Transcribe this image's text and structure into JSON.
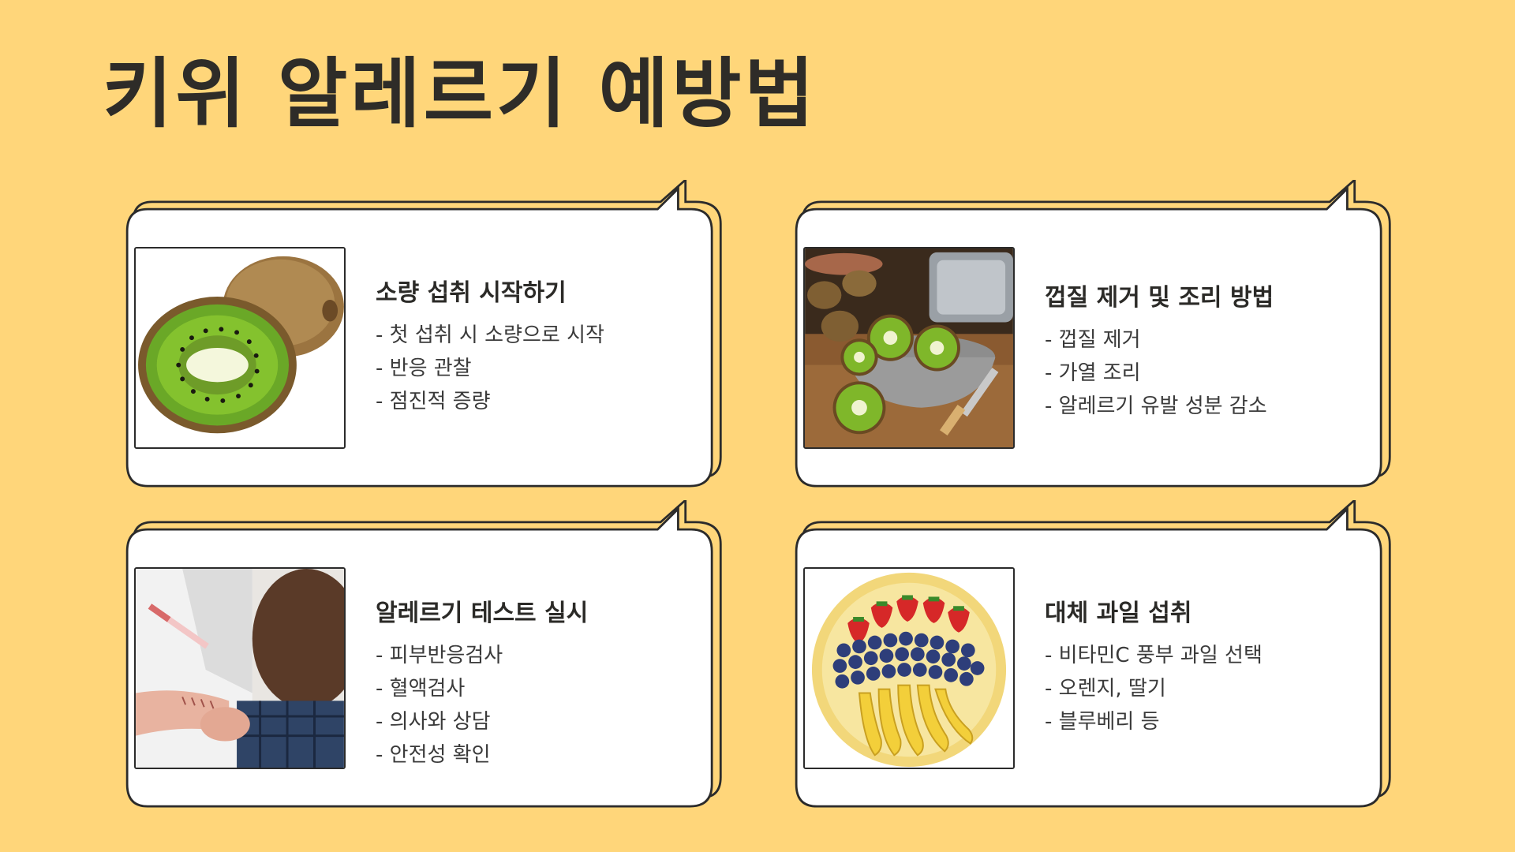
{
  "title": "키위 알레르기 예방법",
  "colors": {
    "background": "#FFD67A",
    "card_fill": "#FFFFFF",
    "card_outline": "#2B2B2B",
    "card_shadow": "#FFD67A"
  },
  "cards": [
    {
      "heading": "소량 섭취 시작하기",
      "icon": "kiwi-halves-image",
      "items": [
        "- 첫 섭취 시 소량으로 시작",
        "- 반응 관찰",
        "- 점진적 증량"
      ]
    },
    {
      "heading": "껍질 제거 및 조리 방법",
      "icon": "kiwi-bowl-kitchen-image",
      "items": [
        "- 껍질 제거",
        "- 가열 조리",
        "- 알레르기 유발 성분 감소"
      ]
    },
    {
      "heading": "알레르기 테스트 실시",
      "icon": "skin-allergy-test-image",
      "items": [
        "- 피부반응검사",
        "- 혈액검사",
        "- 의사와 상담",
        "- 안전성 확인"
      ]
    },
    {
      "heading": "대체 과일 섭취",
      "icon": "fruit-plate-image",
      "items": [
        "- 비타민C 풍부 과일 선택",
        "- 오렌지, 딸기",
        "- 블루베리 등"
      ]
    }
  ]
}
